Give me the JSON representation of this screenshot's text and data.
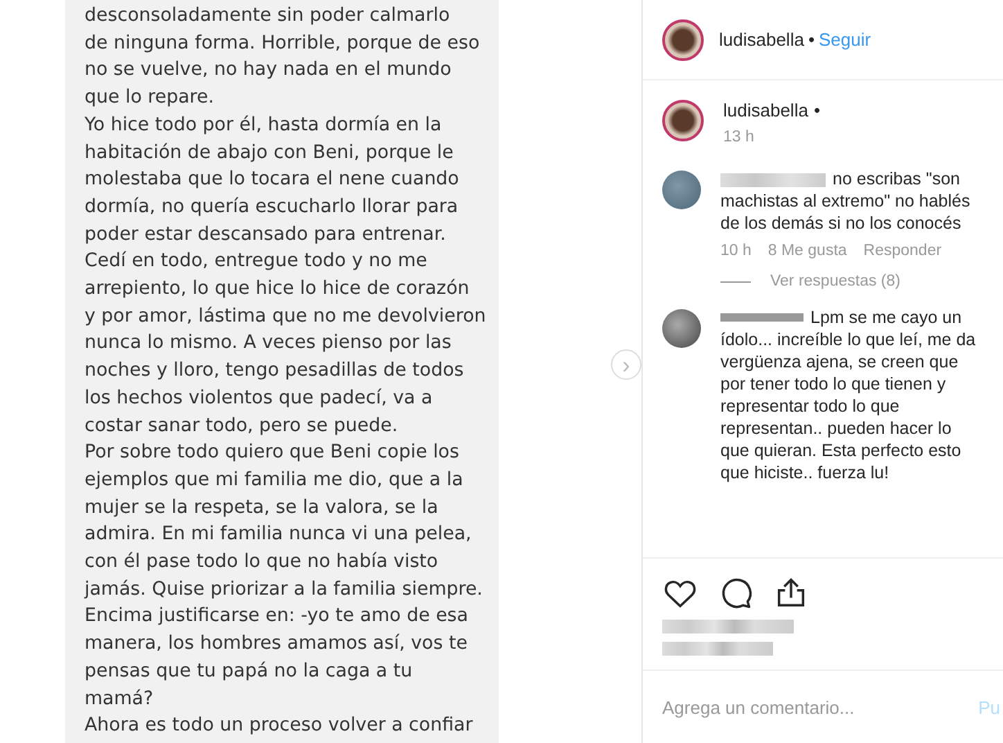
{
  "post_image": {
    "lines": [
      "desconsoladamente sin poder calmarlo",
      "de ninguna forma. Horrible, porque de eso",
      "no se vuelve, no hay nada en el mundo",
      "que lo repare.",
      "Yo hice todo por él, hasta dormía en la",
      "habitación de abajo con Beni, porque le",
      "molestaba que lo tocara el nene cuando",
      "dormía, no quería escucharlo llorar para",
      "poder estar descansado para entrenar.",
      "Cedí en todo, entregue todo y no me",
      "arrepiento, lo que hice lo hice de corazón",
      "y por amor, lástima que no me devolvieron",
      "nunca lo mismo. A veces pienso por las",
      "noches y lloro, tengo pesadillas de todos",
      "los hechos violentos que padecí, va a",
      "costar sanar todo, pero se puede.",
      "Por sobre todo quiero que Beni copie los",
      "ejemplos que mi familia me dio, que a la",
      "mujer se la respeta, se la valora, se la",
      "admira. En mi familia nunca vi una pelea,",
      "con él pase todo lo que no había visto",
      "jamás. Quise priorizar a la familia siempre.",
      "Encima justificarse en: -yo te amo de esa",
      "manera, los hombres amamos así, vos te",
      "pensas que tu papá no la caga a tu",
      "mamá?",
      " Ahora es todo un proceso volver a confiar"
    ]
  },
  "next_button": {
    "label": "›"
  },
  "header": {
    "username": "ludisabella",
    "separator": "•",
    "follow": "Seguir"
  },
  "caption": {
    "username": "ludisabella",
    "separator": "•",
    "time": "13 h"
  },
  "comments": [
    {
      "text": "no escribas \"son machistas al extremo\" no hablés de los demás si no los conocés",
      "time": "10 h",
      "likes": "8 Me gusta",
      "reply": "Responder",
      "view_replies": "Ver respuestas (8)"
    },
    {
      "text": "Lpm se me cayo un ídolo... increíble lo que leí, me da vergüenza ajena, se creen que por tener todo lo que tienen y representar todo lo que representan.. pueden hacer lo que quieran. Esta perfecto esto que hiciste.. fuerza lu!"
    }
  ],
  "add_comment": {
    "placeholder": "Agrega un comentario...",
    "post": "Pu"
  }
}
